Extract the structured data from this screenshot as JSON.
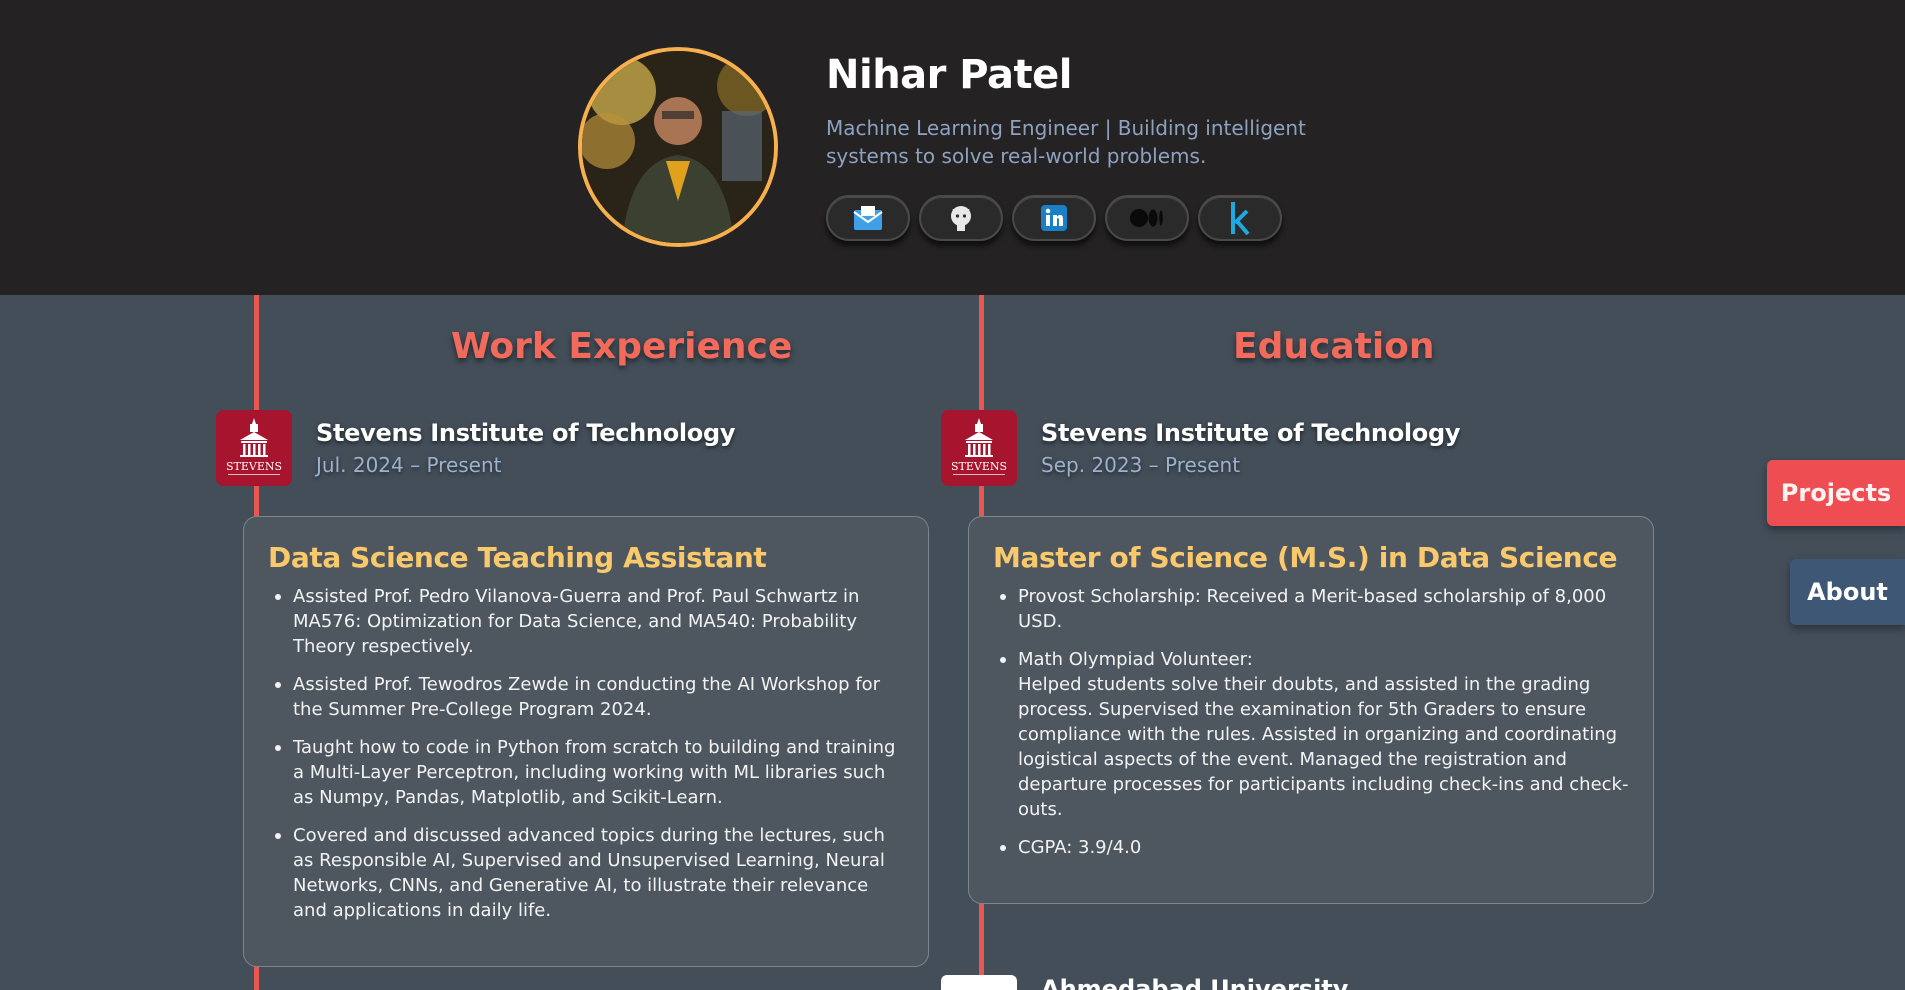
{
  "profile": {
    "name": "Nihar Patel",
    "tagline": "Machine Learning Engineer | Building intelligent systems to solve real-world problems."
  },
  "socials": [
    {
      "icon": "email-icon"
    },
    {
      "icon": "github-icon"
    },
    {
      "icon": "linkedin-icon"
    },
    {
      "icon": "medium-icon"
    },
    {
      "icon": "kaggle-icon"
    }
  ],
  "work": {
    "section_title": "Work Experience",
    "org": "Stevens Institute of Technology",
    "date": "Jul. 2024 – Present",
    "logo_text": "STEVENS",
    "role": "Data Science Teaching Assistant",
    "bullets": [
      "Assisted Prof. Pedro Vilanova-Guerra and Prof. Paul Schwartz in MA576: Optimization for Data Science, and MA540: Probability Theory respectively.",
      "Assisted Prof. Tewodros Zewde in conducting the AI Workshop for the Summer Pre-College Program 2024.",
      "Taught how to code in Python from scratch to building and training a Multi-Layer Perceptron, including working with ML libraries such as Numpy, Pandas, Matplotlib, and Scikit-Learn.",
      "Covered and discussed advanced topics during the lectures, such as Responsible AI, Supervised and Unsupervised Learning, Neural Networks, CNNs, and Generative AI, to illustrate their relevance and applications in daily life."
    ]
  },
  "education": {
    "section_title": "Education",
    "org": "Stevens Institute of Technology",
    "date": "Sep. 2023 – Present",
    "logo_text": "STEVENS",
    "degree": "Master of Science (M.S.) in Data Science",
    "bullets": {
      "scholarship": "Provost Scholarship: Received a Merit-based scholarship of 8,000 USD.",
      "olympiad_head": "Math Olympiad Volunteer:",
      "olympiad_body": "Helped students solve their doubts, and assisted in the grading process. Supervised the examination for 5th Graders to ensure compliance with the rules. Assisted in organizing and coordinating logistical aspects of the event. Managed the registration and departure processes for participants including check-ins and check-outs.",
      "cgpa": "CGPA: 3.9/4.0"
    },
    "next_org": "Ahmedabad University"
  },
  "nav": {
    "projects": "Projects",
    "about": "About"
  },
  "colors": {
    "accent_red": "#e9574f",
    "title_gold": "#f9c96b",
    "header_bg": "#242222",
    "body_bg": "#434e59"
  }
}
